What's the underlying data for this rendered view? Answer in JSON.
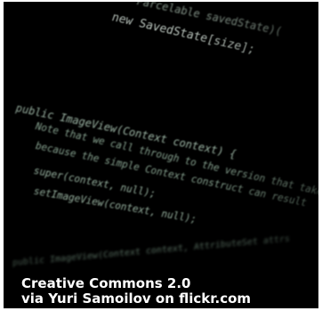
{
  "credit": {
    "line1": "Creative Commons 2.0",
    "line2": "via Yuri Samoilov on flickr.com"
  }
}
